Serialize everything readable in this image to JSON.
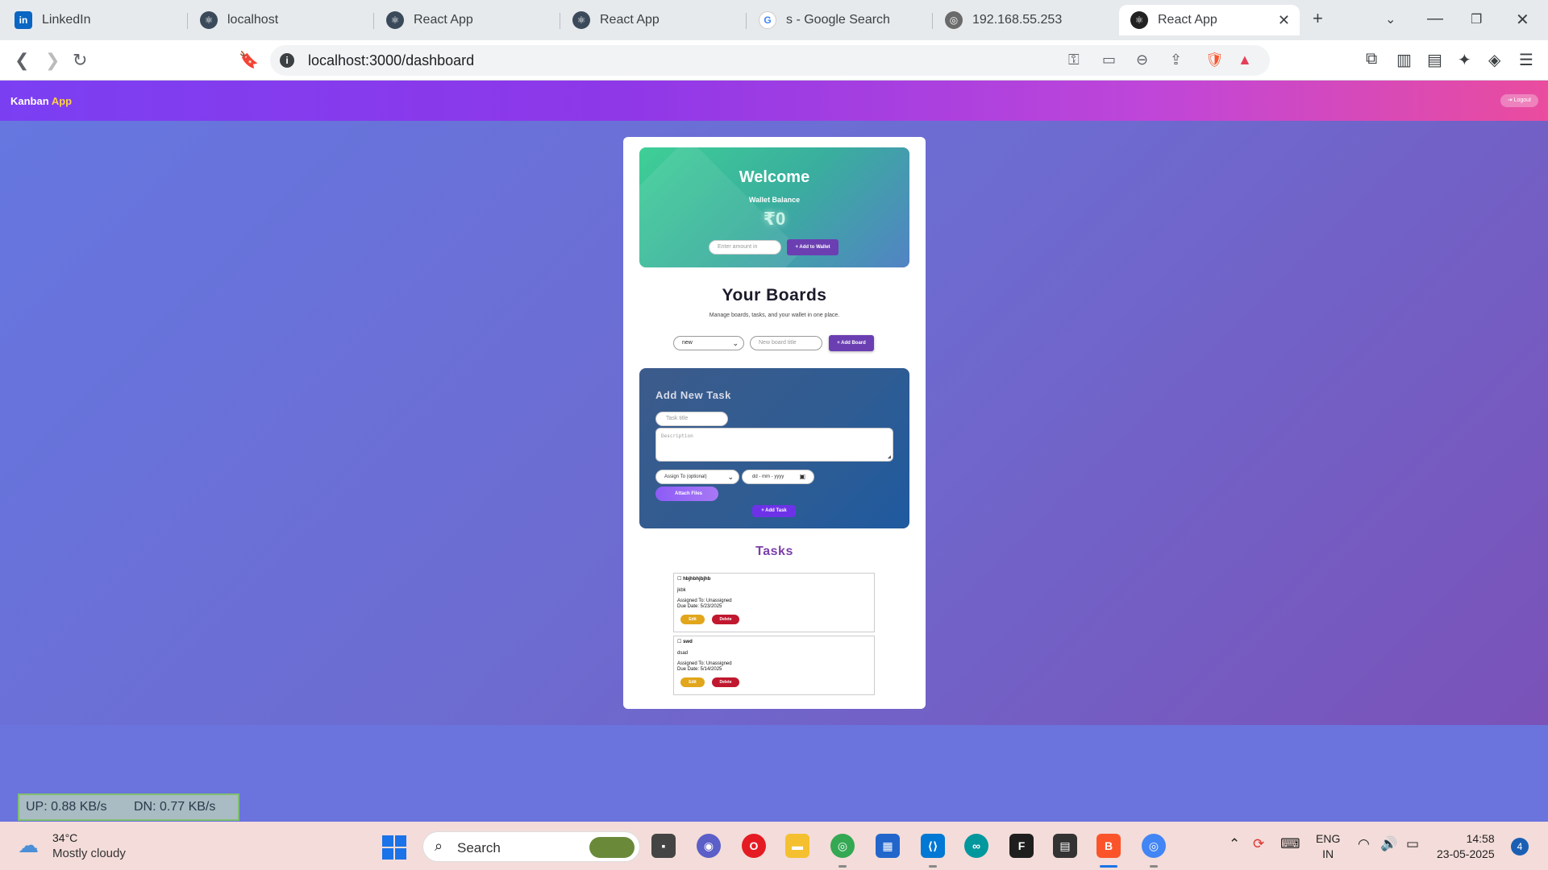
{
  "browser": {
    "tabs": [
      {
        "title": "LinkedIn",
        "icon": "linkedin-icon"
      },
      {
        "title": "localhost",
        "icon": "react-icon"
      },
      {
        "title": "React App",
        "icon": "react-icon"
      },
      {
        "title": "React App",
        "icon": "react-icon"
      },
      {
        "title": "s - Google Search",
        "icon": "google-icon"
      },
      {
        "title": "192.168.55.253",
        "icon": "globe-icon"
      },
      {
        "title": "React App",
        "icon": "react-icon",
        "active": true
      }
    ],
    "url": "localhost:3000/dashboard",
    "brave_badge": "1"
  },
  "header": {
    "brand_part1": "Kanban",
    "brand_part2": "App",
    "logout_label": "Logout"
  },
  "welcome": {
    "title": "Welcome",
    "wallet_label": "Wallet Balance",
    "balance": "₹0",
    "amount_placeholder": "Enter amount in",
    "add_wallet_label": "+ Add to Wallet"
  },
  "boards": {
    "title": "Your Boards",
    "subtitle": "Manage boards, tasks, and your wallet in one place.",
    "selected_board": "new",
    "new_board_placeholder": "New board title",
    "add_board_label": "+ Add Board"
  },
  "task_form": {
    "title": "Add New Task",
    "title_placeholder": "Task title",
    "description_placeholder": "Description",
    "assign_placeholder": "Assign To (optional)",
    "date_placeholder": "dd - mm - yyyy",
    "attach_label": "Attach Files",
    "add_task_label": "+ Add Task"
  },
  "tasks": {
    "title": "Tasks",
    "items": [
      {
        "name": "hbjhbhjbjhb",
        "description": "jkbk",
        "assigned": "Assigned To: Unassigned",
        "due": "Due Date: 5/23/2025",
        "edit_label": "Edit",
        "delete_label": "Delete"
      },
      {
        "name": "swd",
        "description": "dsad",
        "assigned": "Assigned To: Unassigned",
        "due": "Due Date: 5/14/2025",
        "edit_label": "Edit",
        "delete_label": "Delete"
      }
    ]
  },
  "netmon": {
    "up": "UP: 0.88 KB/s",
    "down": "DN: 0.77 KB/s"
  },
  "taskbar": {
    "temperature": "34°C",
    "weather": "Mostly cloudy",
    "search_label": "Search",
    "lang_line1": "ENG",
    "lang_line2": "IN",
    "time": "14:58",
    "date": "23-05-2025",
    "notification_count": "4"
  },
  "colors": {
    "header_start": "#7b3ff2",
    "header_end": "#ea4c9e",
    "button_purple": "#6b3fb2",
    "edit_yellow": "#e2a61c",
    "delete_red": "#c0182f",
    "tasks_title": "#7a3fa8"
  }
}
